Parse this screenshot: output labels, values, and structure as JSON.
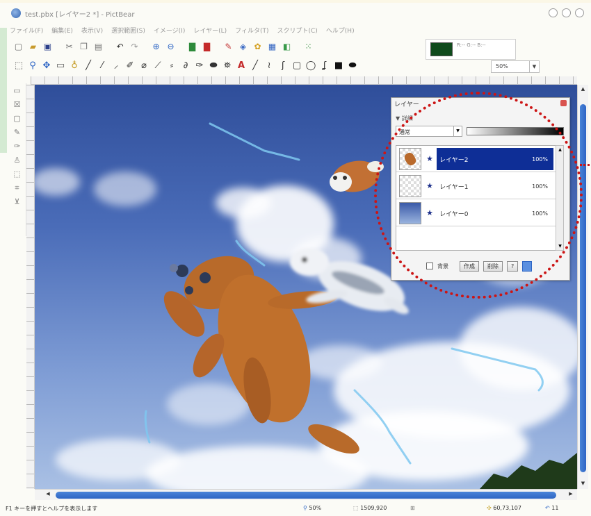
{
  "window": {
    "title": "test.pbx [レイヤー2 *] - PictBear"
  },
  "menu": {
    "items": [
      "ファイル(F)",
      "編集(E)",
      "表示(V)",
      "選択範囲(S)",
      "イメージ(I)",
      "レイヤー(L)",
      "フィルタ(T)",
      "スクリプト(C)",
      "ヘルプ(H)"
    ]
  },
  "toolbar": {
    "icons": [
      "new-file-icon",
      "open-file-icon",
      "save-icon",
      "cut-icon",
      "copy-icon",
      "paste-icon",
      "undo-icon",
      "redo-icon",
      "zoom-in-icon",
      "zoom-out-icon",
      "image-icon",
      "layer-icon",
      "brush-icon",
      "layers-icon",
      "palette-icon",
      "settings-icon",
      "grid-icon"
    ],
    "tools": [
      "select-rect-icon",
      "zoom-icon",
      "move-icon",
      "marquee-icon",
      "lasso-icon",
      "pencil-icon",
      "brush-icon",
      "airbrush-icon",
      "eraser-icon",
      "bucket-icon",
      "gradient-icon",
      "eyedropper-icon",
      "smudge-icon",
      "stamp-icon",
      "hand-icon",
      "text-icon",
      "line-icon",
      "curve-icon",
      "path-icon",
      "rect-icon",
      "ellipse-icon",
      "pen-icon",
      "fill-rect-icon",
      "fill-ellipse-icon"
    ]
  },
  "color": {
    "foreground": "#0f4a1c",
    "values": "R:-- G:-- B:--"
  },
  "zoom": {
    "value": "50%"
  },
  "layers_panel": {
    "title": "レイヤー",
    "subtitle": "▼ 詳細",
    "blend_mode": "通常",
    "layers": [
      {
        "name": "レイヤー2",
        "opacity": "100%",
        "selected": true,
        "thumb": "dog"
      },
      {
        "name": "レイヤー1",
        "opacity": "100%",
        "selected": false,
        "thumb": "transparent"
      },
      {
        "name": "レイヤー0",
        "opacity": "100%",
        "selected": false,
        "thumb": "sky"
      }
    ],
    "background_label": "背景",
    "btn_new": "作成",
    "btn_delete": "削除",
    "btn_extra": "?"
  },
  "status": {
    "hint": "F1 キーを押すとヘルプを表示します",
    "zoom": "50%",
    "image_size": "1509,920",
    "position": "60,73,107",
    "count": "11"
  },
  "annotation": {
    "circle_color": "#cc1515"
  }
}
